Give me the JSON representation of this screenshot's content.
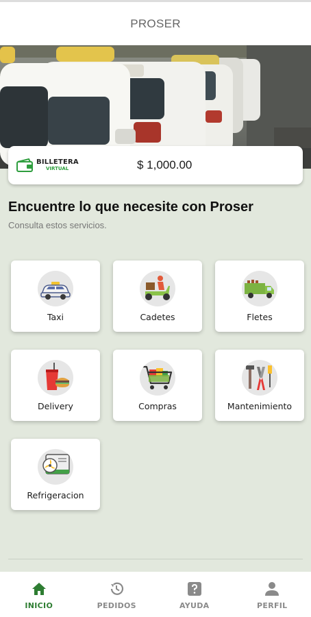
{
  "app_bar": {
    "title": "PROSER"
  },
  "hero": {
    "image": "taxi-line-photo"
  },
  "wallet": {
    "logo_line1": "BILLETERA",
    "logo_line2": "VIRTUAL",
    "balance": "$ 1,000.00"
  },
  "main": {
    "heading": "Encuentre lo que necesite con Proser",
    "subheading": "Consulta estos servicios."
  },
  "services": [
    {
      "label": "Taxi",
      "icon": "taxi-icon"
    },
    {
      "label": "Cadetes",
      "icon": "scooter-courier-icon"
    },
    {
      "label": "Fletes",
      "icon": "truck-icon"
    },
    {
      "label": "Delivery",
      "icon": "fast-food-icon"
    },
    {
      "label": "Compras",
      "icon": "shopping-cart-icon"
    },
    {
      "label": "Mantenimiento",
      "icon": "tools-icon"
    },
    {
      "label": "Refrigeracion",
      "icon": "air-conditioner-icon"
    }
  ],
  "bottom_nav": [
    {
      "label": "INICIO",
      "icon": "home-icon",
      "active": true
    },
    {
      "label": "PEDIDOS",
      "icon": "history-icon",
      "active": false
    },
    {
      "label": "AYUDA",
      "icon": "help-icon",
      "active": false
    },
    {
      "label": "PERFIL",
      "icon": "person-icon",
      "active": false
    }
  ],
  "colors": {
    "accent": "#2e7d32",
    "background": "#e2e8dd",
    "nav_inactive": "#8a8a8a",
    "wallet_green": "#2e9e3e"
  }
}
